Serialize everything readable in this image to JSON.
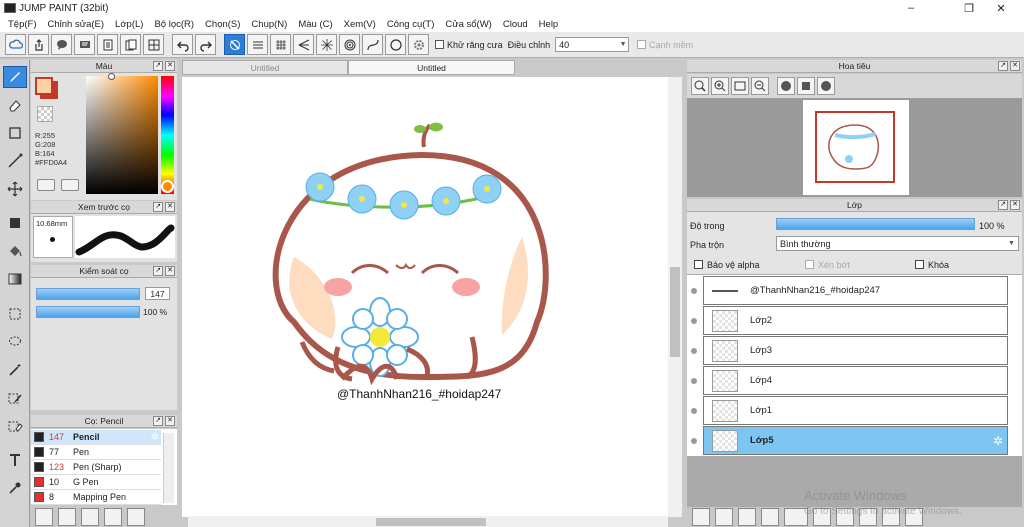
{
  "window": {
    "title": "JUMP PAINT (32bit)",
    "controls": [
      "–",
      "❐",
      "✕"
    ]
  },
  "menu": [
    "Tệp(F)",
    "Chỉnh sửa(E)",
    "Lớp(L)",
    "Bộ lọc(R)",
    "Chọn(S)",
    "Chụp(N)",
    "Màu (C)",
    "Xem(V)",
    "Công cụ(T)",
    "Cửa sổ(W)",
    "Cloud",
    "Help"
  ],
  "toolbar": {
    "antialias_label": "Khử răng cưa",
    "adjust_label": "Điều chỉnh",
    "adjust_value": "40",
    "snap_label": "Cạnh mềm"
  },
  "color_panel": {
    "title": "Màu",
    "r": "R:255",
    "g": "G:208",
    "b": "B:164",
    "hex": "#FFD0A4",
    "main_color": "#FFD0A4",
    "sub_color": "#c0392b"
  },
  "brush_preview": {
    "title": "Xem trước cọ",
    "size": "10.68mm"
  },
  "brush_control": {
    "title": "Kiểm soát cọ",
    "size_value": "147",
    "opacity_value": "100 %",
    "size_fraction": 1.0,
    "opacity_fraction": 1.0
  },
  "brush_list": {
    "title": "Cọ: Pencil",
    "items": [
      {
        "size": "147",
        "name": "Pencil",
        "swatch": "#222222",
        "red": true,
        "selected": true
      },
      {
        "size": "77",
        "name": "Pen",
        "swatch": "#222222",
        "red": false,
        "selected": false
      },
      {
        "size": "123",
        "name": "Pen (Sharp)",
        "swatch": "#222222",
        "red": true,
        "selected": false
      },
      {
        "size": "10",
        "name": "G Pen",
        "swatch": "#e53030",
        "red": false,
        "selected": false
      },
      {
        "size": "8",
        "name": "Mapping Pen",
        "swatch": "#e53030",
        "red": false,
        "selected": false
      }
    ]
  },
  "tabs": [
    "Untitled",
    "Untitled"
  ],
  "canvas": {
    "watermark_text": "@ThanhNhan216_#hoidap247"
  },
  "navigator": {
    "title": "Hoa tiêu"
  },
  "layer_panel": {
    "title": "Lớp",
    "opacity_label": "Độ trong",
    "opacity_value": "100 %",
    "opacity_fraction": 1.0,
    "blend_label": "Pha trộn",
    "blend_value": "Bình thường",
    "protect_alpha_label": "Bảo vệ alpha",
    "clip_label": "Xén bớt",
    "lock_label": "Khóa",
    "layers": [
      {
        "name": "@ThanhNhan216_#hoidap247",
        "selected": false
      },
      {
        "name": "Lớp2",
        "selected": false
      },
      {
        "name": "Lớp3",
        "selected": false
      },
      {
        "name": "Lớp4",
        "selected": false
      },
      {
        "name": "Lớp1",
        "selected": false
      },
      {
        "name": "Lớp5",
        "selected": true
      }
    ]
  },
  "os_watermark": {
    "line1": "Activate Windows",
    "line2": "Go to Settings to activate Windows."
  }
}
